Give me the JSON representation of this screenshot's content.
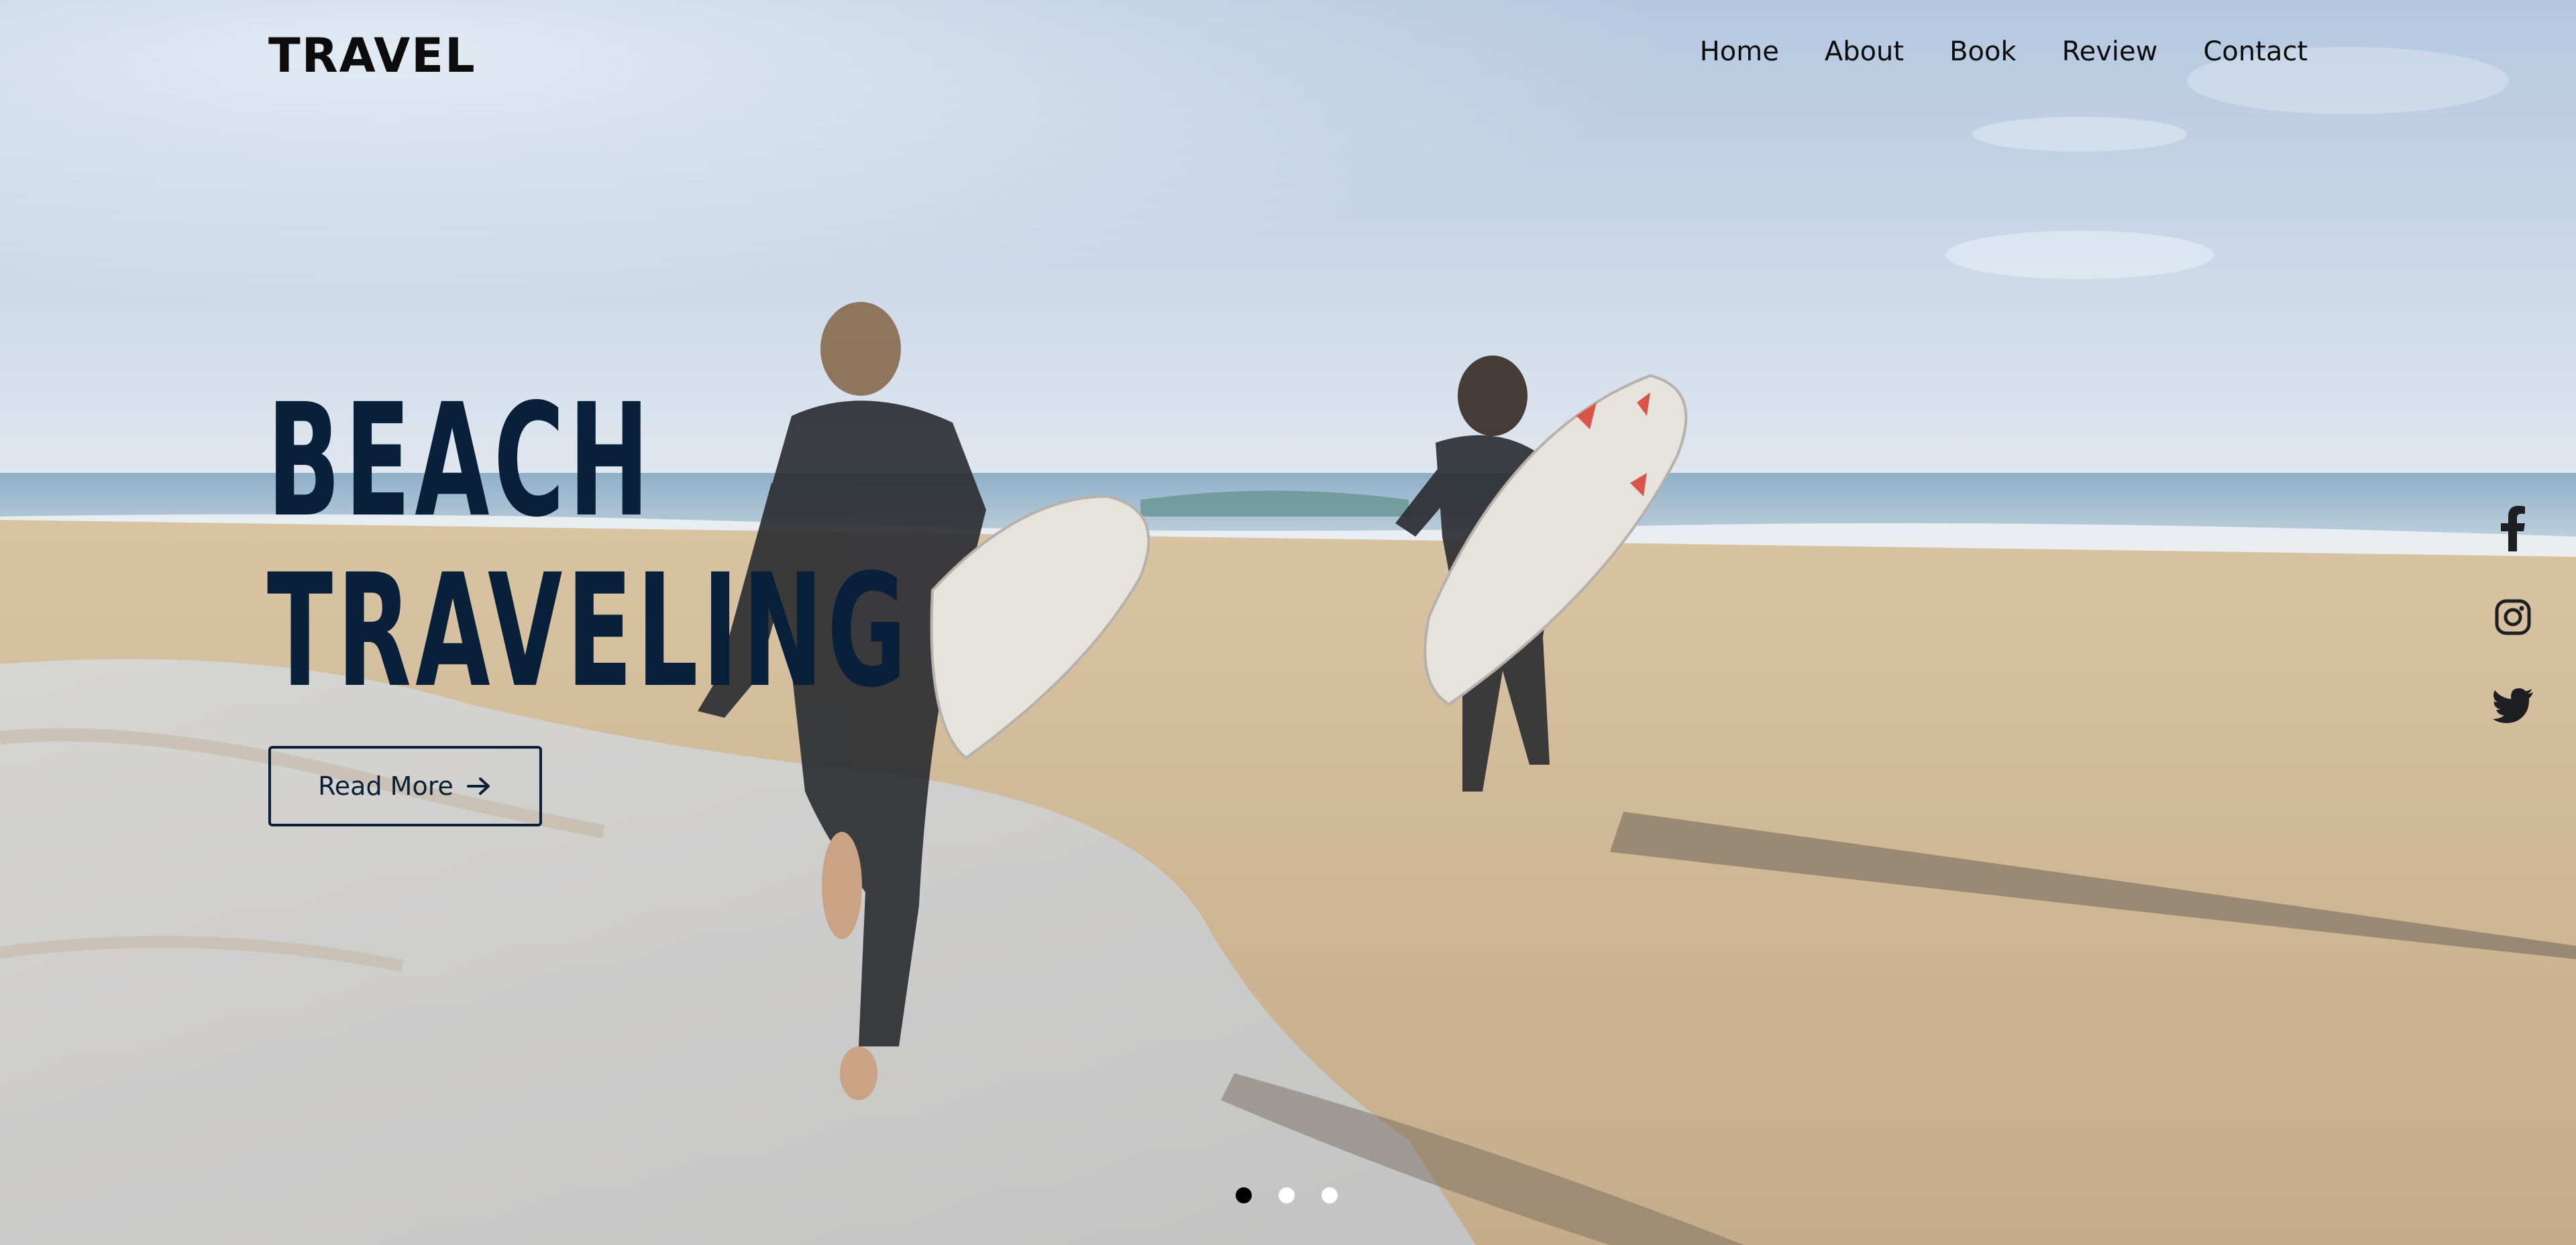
{
  "header": {
    "logo": "TRAVEL",
    "nav": [
      "Home",
      "About",
      "Book",
      "Review",
      "Contact"
    ]
  },
  "hero": {
    "title_line1": "BEACH",
    "title_line2": "TRAVELING",
    "button_label": "Read More",
    "button_icon": "arrow-right-icon"
  },
  "social": {
    "icons": [
      "facebook-icon",
      "instagram-icon",
      "twitter-icon"
    ]
  },
  "slider": {
    "slide_count": 3,
    "active_index": 0
  },
  "colors": {
    "headline": "#08203a",
    "logo": "#0c0c0c",
    "accent": "#0a2037"
  }
}
